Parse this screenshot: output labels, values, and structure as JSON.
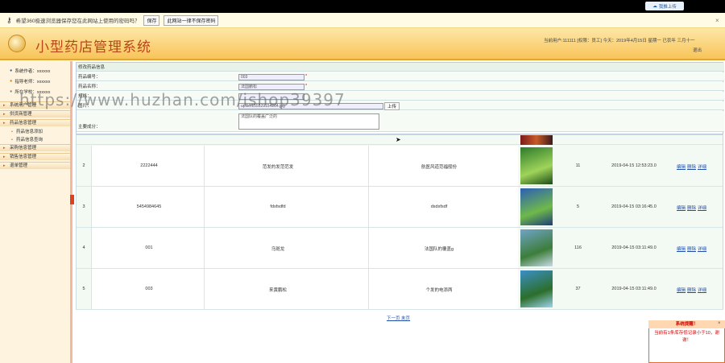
{
  "browser": {
    "cloud_button": "我推上传",
    "password_bar": {
      "prompt": "希望360极速浏览器保存您在此网站上使用的密码吗？",
      "save_label": "保存",
      "never_label": "此网站一律不保存密码",
      "close": "×"
    }
  },
  "header": {
    "app_title": "小型药店管理系统",
    "user_info": "当前用户:111111 [权限：员工] 今天：2019年4月15日 星期一 已农年 三月十一",
    "logout": "退出"
  },
  "sidebar": {
    "info": [
      {
        "label": "系统作者：xxxxxx",
        "icon": "user-icon"
      },
      {
        "label": "指导老师：xxxxxx",
        "icon": "teacher-icon"
      },
      {
        "label": "所在学校：xxxxxx",
        "icon": "school-icon"
      }
    ],
    "menus": [
      {
        "label": "系统用户管理"
      },
      {
        "label": "供货商管理"
      },
      {
        "label": "药品信息管理",
        "subs": [
          "药品信息添加",
          "药品信息查询"
        ]
      },
      {
        "label": "采购信息管理"
      },
      {
        "label": "销售信息管理"
      },
      {
        "label": "退单管理"
      }
    ]
  },
  "form": {
    "section_title": "修改药品信息",
    "rows": [
      {
        "label": "药品编号：",
        "value": "003",
        "required": "*"
      },
      {
        "label": "药品名称：",
        "value": "法国鹏松",
        "required": "*"
      },
      {
        "label": "规格：",
        "value": "",
        "required": ""
      },
      {
        "label": "图片：",
        "value": "upfile/155529154264.jpg",
        "button": "上传"
      },
      {
        "label": "主要成分：",
        "value": "法国队的覆盖广泛的"
      }
    ]
  },
  "watermark": "https://www.huzhan.com/ishop39397",
  "table": {
    "rows": [
      {
        "index": "2",
        "code": "2222444",
        "name": "范发的发范范发",
        "spec": "航医风道范福般份",
        "stock": "11",
        "time": "2019-04-15 12:53:23.0",
        "colors": [
          "#2d7a2b",
          "#9fd45a",
          "#1c4a18"
        ]
      },
      {
        "index": "3",
        "code": "5454984645",
        "name": "fdsfsdfd",
        "spec": "dsdsfsdf",
        "stock": "5",
        "time": "2019-04-15 03:16:45.0",
        "colors": [
          "#2b5fb5",
          "#6fb94a",
          "#1d3c7a"
        ]
      },
      {
        "index": "4",
        "code": "001",
        "name": "乌斑龙",
        "spec": "法国队的覆盖g",
        "stock": "116",
        "time": "2019-04-15 03:11:49.0",
        "colors": [
          "#6fa4c8",
          "#3d7d3a",
          "#c8dbe8"
        ]
      },
      {
        "index": "5",
        "code": "003",
        "name": "来黄鹏松",
        "spec": "个发的电添两",
        "stock": "37",
        "time": "2019-04-15 03:11:49.0",
        "colors": [
          "#3b8fc8",
          "#2c6e2a",
          "#9dd3ef"
        ]
      }
    ],
    "actions": [
      "编辑",
      "删除",
      "详细"
    ]
  },
  "pager": {
    "next": "下一页",
    "last": "末页"
  },
  "notice": {
    "title": "系统提醒！",
    "body": "当前有1条库存低记录小于10，谢谢！",
    "close": "×"
  }
}
